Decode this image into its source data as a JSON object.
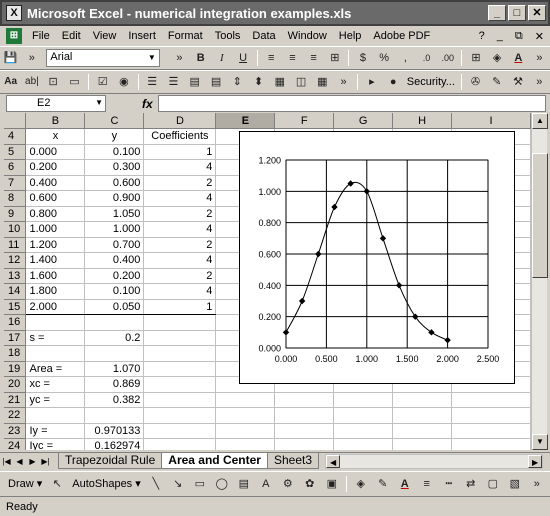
{
  "window": {
    "title": "Microsoft Excel - numerical integration examples.xls",
    "app_icon_letter": "X"
  },
  "menu": [
    "File",
    "Edit",
    "View",
    "Insert",
    "Format",
    "Tools",
    "Data",
    "Window",
    "Help",
    "Adobe PDF"
  ],
  "help_question_mark": "?",
  "font_name": "Arial",
  "security_label": "Security...",
  "name_box": "E2",
  "fx_label": "fx",
  "columns": [
    "B",
    "C",
    "D",
    "E",
    "F",
    "G",
    "H",
    "I"
  ],
  "rows": [
    {
      "n": "4",
      "B": "x",
      "C": "y",
      "D": "Coefficients"
    },
    {
      "n": "5",
      "B": "0.000",
      "C": "0.100",
      "D": "1"
    },
    {
      "n": "6",
      "B": "0.200",
      "C": "0.300",
      "D": "4"
    },
    {
      "n": "7",
      "B": "0.400",
      "C": "0.600",
      "D": "2"
    },
    {
      "n": "8",
      "B": "0.600",
      "C": "0.900",
      "D": "4"
    },
    {
      "n": "9",
      "B": "0.800",
      "C": "1.050",
      "D": "2"
    },
    {
      "n": "10",
      "B": "1.000",
      "C": "1.000",
      "D": "4"
    },
    {
      "n": "11",
      "B": "1.200",
      "C": "0.700",
      "D": "2"
    },
    {
      "n": "12",
      "B": "1.400",
      "C": "0.400",
      "D": "4"
    },
    {
      "n": "13",
      "B": "1.600",
      "C": "0.200",
      "D": "2"
    },
    {
      "n": "14",
      "B": "1.800",
      "C": "0.100",
      "D": "4"
    },
    {
      "n": "15",
      "B": "2.000",
      "C": "0.050",
      "D": "1"
    },
    {
      "n": "16",
      "B": "",
      "C": "",
      "D": ""
    },
    {
      "n": "17",
      "B": "s =",
      "C": "0.2",
      "D": ""
    },
    {
      "n": "18",
      "B": "",
      "C": "",
      "D": ""
    },
    {
      "n": "19",
      "B": "Area =",
      "C": "1.070",
      "D": ""
    },
    {
      "n": "20",
      "B": "xc =",
      "C": "0.869",
      "D": ""
    },
    {
      "n": "21",
      "B": "yc =",
      "C": "0.382",
      "D": ""
    },
    {
      "n": "22",
      "B": "",
      "C": "",
      "D": ""
    },
    {
      "n": "23",
      "B": "Iy =",
      "C": "0.970133",
      "D": ""
    },
    {
      "n": "24",
      "B": "Iyc =",
      "C": "0.162974",
      "D": ""
    }
  ],
  "sheet_tabs": [
    {
      "label": "Trapezoidal Rule",
      "active": false
    },
    {
      "label": "Area and Center",
      "active": true
    },
    {
      "label": "Sheet3",
      "active": false
    }
  ],
  "draw_label": "Draw",
  "autoshapes_label": "AutoShapes",
  "status": "Ready",
  "chart_data": {
    "type": "scatter",
    "x": [
      0.0,
      0.2,
      0.4,
      0.6,
      0.8,
      1.0,
      1.2,
      1.4,
      1.6,
      1.8,
      2.0
    ],
    "series": [
      {
        "values": [
          0.1,
          0.3,
          0.6,
          0.9,
          1.05,
          1.0,
          0.7,
          0.4,
          0.2,
          0.1,
          0.05
        ]
      }
    ],
    "xlim": [
      0,
      2.5
    ],
    "ylim": [
      0,
      1.2
    ],
    "x_ticks": [
      "0.000",
      "0.500",
      "1.000",
      "1.500",
      "2.000",
      "2.500"
    ],
    "y_ticks": [
      "0.000",
      "0.200",
      "0.400",
      "0.600",
      "0.800",
      "1.000",
      "1.200"
    ],
    "grid": true,
    "smoothed_line": true,
    "marker": "diamond",
    "line_color": "#000000"
  }
}
